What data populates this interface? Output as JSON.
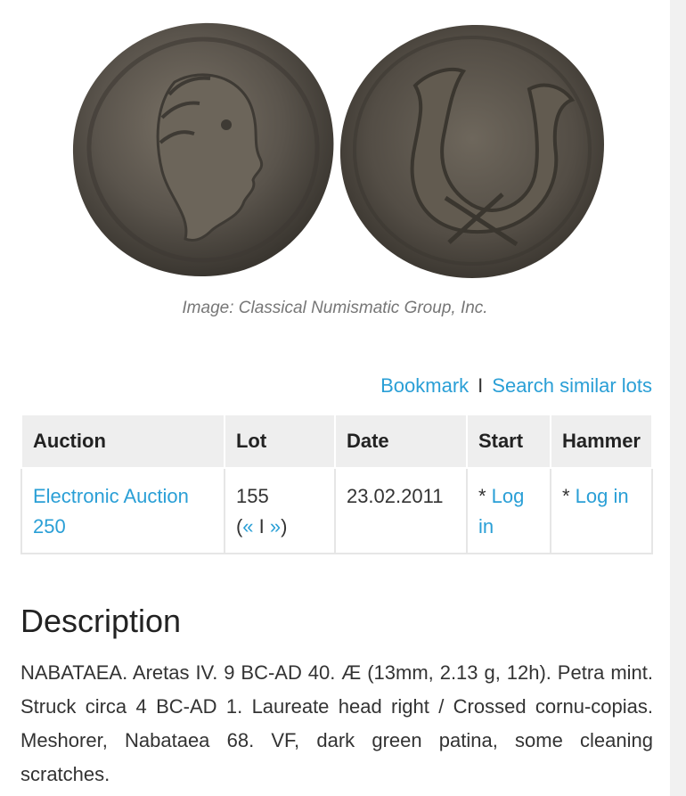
{
  "image": {
    "caption": "Image: Classical Numismatic Group, Inc.",
    "colors": {
      "coin_dark": "#4a4640",
      "coin_light": "#7a7266"
    }
  },
  "actions": {
    "bookmark": "Bookmark",
    "separator": "I",
    "search_similar": "Search similar lots",
    "link_color": "#2a9fd6"
  },
  "table": {
    "headers": {
      "auction": "Auction",
      "lot": "Lot",
      "date": "Date",
      "start": "Start",
      "hammer": "Hammer"
    },
    "row": {
      "auction": "Electronic Auction 250",
      "lot": "155",
      "lot_nav_open": "(",
      "lot_prev": "«",
      "lot_nav_sep": " I ",
      "lot_next": "»",
      "lot_nav_close": ")",
      "date": "23.02.2011",
      "start_prefix": "* ",
      "start_link": "Log in",
      "hammer_prefix": "* ",
      "hammer_link": "Log in"
    }
  },
  "description": {
    "title": "Description",
    "text": "NABATAEA. Aretas IV. 9 BC-AD 40. Æ (13mm, 2.13 g, 12h). Petra mint. Struck circa 4 BC-AD 1. Laureate head right / Crossed cornu-copias. Meshorer, Nabataea 68. VF, dark green patina, some cleaning scratches."
  }
}
